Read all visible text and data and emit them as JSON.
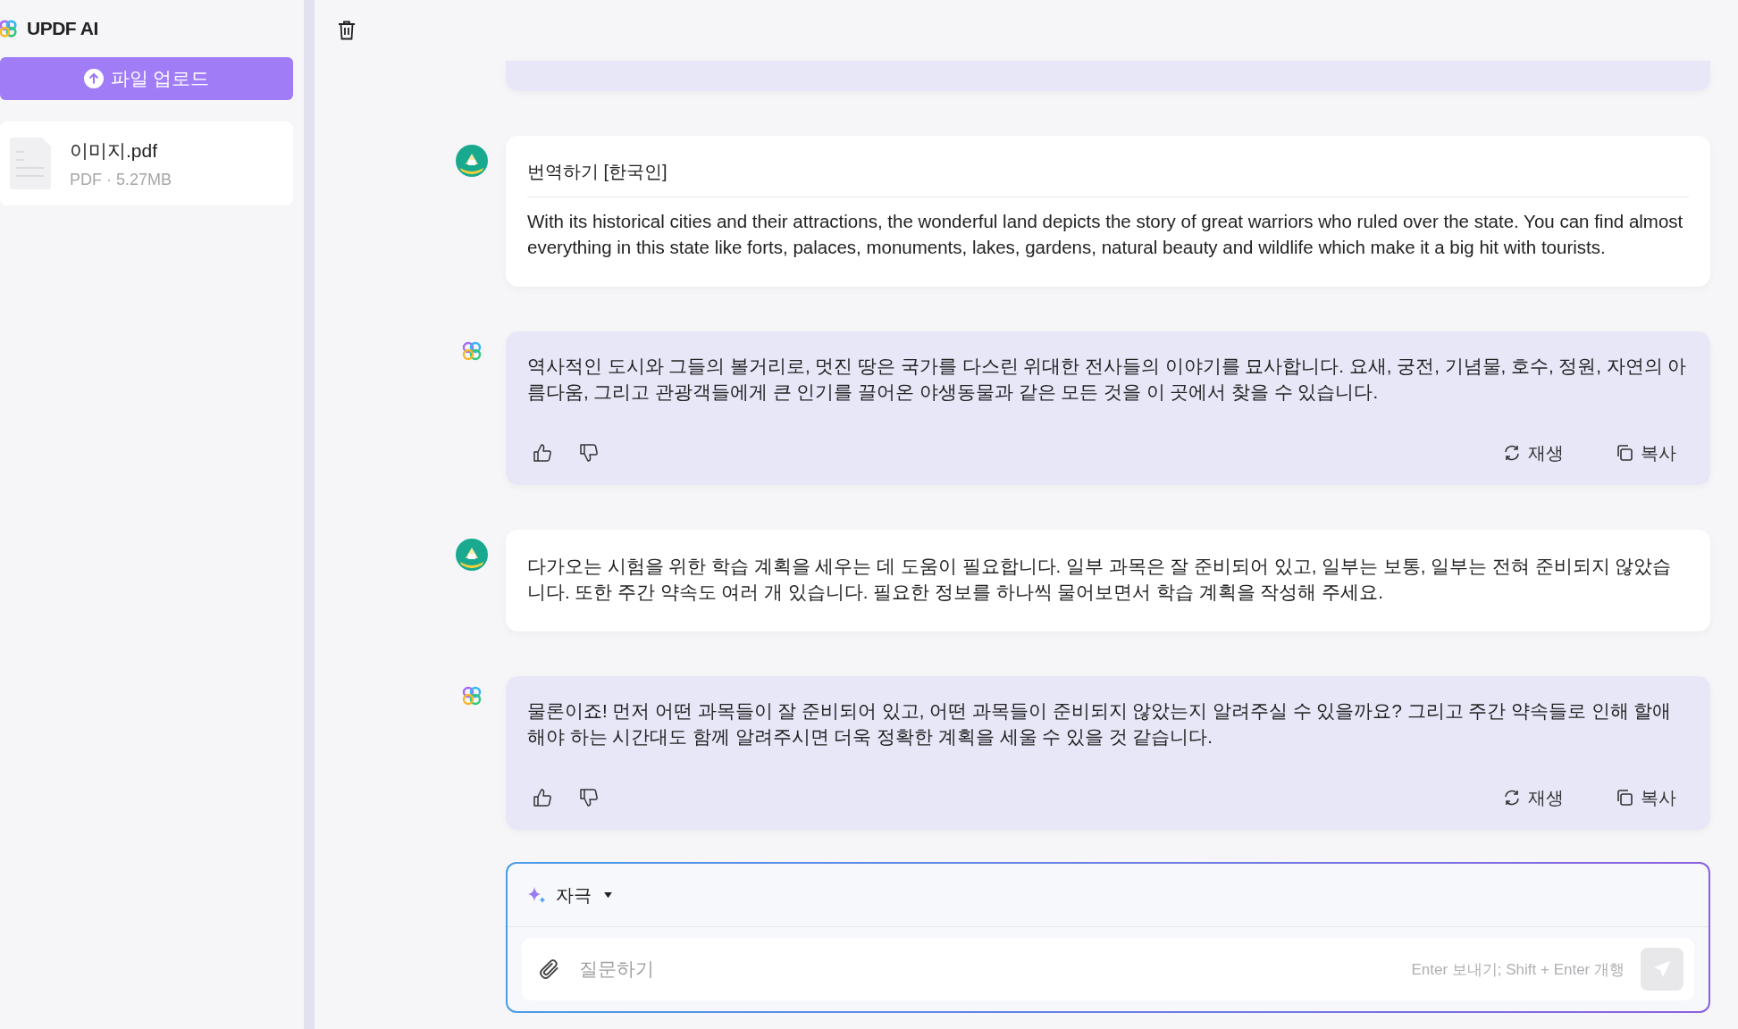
{
  "sidebar": {
    "title": "UPDF AI",
    "upload_button": "파일 업로드",
    "files": [
      {
        "name": "이미지.pdf",
        "meta": "PDF · 5.27MB"
      }
    ]
  },
  "messages": [
    {
      "kind": "user",
      "title": "번역하기 [한국인]",
      "text": "With its historical cities and their attractions, the wonderful land depicts the story of great warriors who ruled over the state. You can find almost everything in this state like forts, palaces, monuments, lakes, gardens, natural beauty and wildlife which make it a big hit with tourists."
    },
    {
      "kind": "ai",
      "text": "역사적인 도시와 그들의 볼거리로, 멋진 땅은 국가를 다스린 위대한 전사들의 이야기를 묘사합니다. 요새, 궁전, 기념물, 호수, 정원, 자연의 아름다움, 그리고 관광객들에게 큰 인기를 끌어온 야생동물과 같은 모든 것을 이 곳에서 찾을 수 있습니다.",
      "actions": [
        "재생",
        "복사"
      ]
    },
    {
      "kind": "user",
      "text": "다가오는 시험을 위한 학습 계획을 세우는 데 도움이 필요합니다. 일부 과목은 잘 준비되어 있고, 일부는 보통, 일부는 전혀 준비되지 않았습니다. 또한 주간 약속도 여러 개 있습니다. 필요한 정보를 하나씩 물어보면서 학습 계획을 작성해 주세요."
    },
    {
      "kind": "ai",
      "text": "물론이죠! 먼저 어떤 과목들이 잘 준비되어 있고, 어떤 과목들이 준비되지 않았는지 알려주실 수 있을까요? 그리고 주간 약속들로 인해 할애해야 하는 시간대도 함께 알려주시면 더욱 정확한 계획을 세울 수 있을 것 같습니다.",
      "actions": [
        "재생",
        "복사"
      ]
    }
  ],
  "composer": {
    "mode": "자극",
    "placeholder": "질문하기",
    "hint": "Enter 보내기; Shift + Enter 개행"
  }
}
